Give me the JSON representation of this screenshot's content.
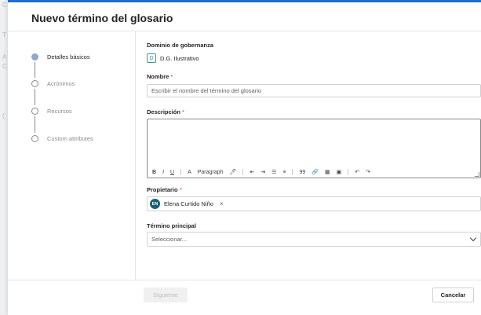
{
  "background": {
    "marks": [
      "C",
      "T",
      "A",
      "C",
      "("
    ]
  },
  "dialog": {
    "title": "Nuevo término del glosario",
    "accent_color": "#1f6fc8"
  },
  "steps": [
    {
      "label": "Detalles básicos",
      "active": true
    },
    {
      "label": "Acrónimos",
      "active": false
    },
    {
      "label": "Recursos",
      "active": false
    },
    {
      "label": "Custom attributes",
      "active": false
    }
  ],
  "form": {
    "domain": {
      "label": "Dominio de gobernanza",
      "badge": "D",
      "value": "D.G. Ilustrativo"
    },
    "name": {
      "label": "Nombre",
      "required_mark": "*",
      "placeholder": "Escribir el nombre del término del glosario"
    },
    "description": {
      "label": "Descripción",
      "required_mark": "*",
      "toolbar": [
        "B",
        "I",
        "U",
        "A",
        "Paragraph",
        "🖊",
        "⇤",
        "⇥",
        "☰",
        "≡",
        "99",
        "🔗",
        "▦",
        "▣",
        "↶",
        "↷"
      ]
    },
    "owner": {
      "label": "Propietario",
      "required_mark": "*",
      "initials": "EN",
      "name": "Elena Curtido Niño",
      "remove": "×"
    },
    "parent_term": {
      "label": "Término principal",
      "placeholder": "Seleccionar..."
    }
  },
  "footer": {
    "next_label": "Siguiente",
    "cancel_label": "Cancelar"
  }
}
